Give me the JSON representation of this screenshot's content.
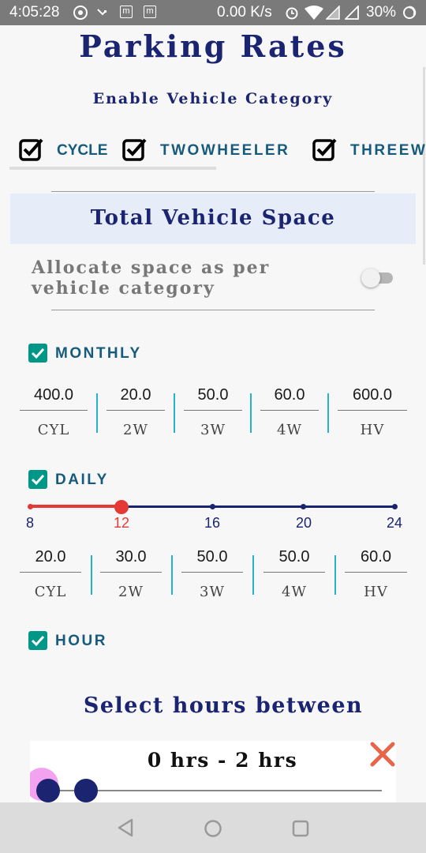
{
  "status_bar": {
    "time": "4:05:28",
    "speed": "0.00 K/s",
    "battery": "30%",
    "icons": [
      "target-icon",
      "missed-call-icon",
      "m-icon",
      "m-icon",
      "alarm-icon",
      "wifi-icon",
      "signal-icon",
      "signal-icon",
      "battery-icon"
    ]
  },
  "page": {
    "title": "Parking Rates",
    "vehicle_category_heading": "Enable Vehicle Category",
    "categories": [
      {
        "label": "CYCLE",
        "checked": true
      },
      {
        "label": "TWOWHEELER",
        "checked": true
      },
      {
        "label": "THREEWHEELER",
        "checked": true
      }
    ],
    "total_space_heading": "Total Vehicle Space",
    "allocate_label": "Allocate space as per vehicle category",
    "allocate_toggle_on": false
  },
  "monthly": {
    "label": "MONTHLY",
    "checked": true,
    "values": [
      "400.0",
      "20.0",
      "50.0",
      "60.0",
      "600.0"
    ],
    "labels": [
      "CYL",
      "2W",
      "3W",
      "4W",
      "HV"
    ]
  },
  "daily": {
    "label": "DAILY",
    "checked": true,
    "slider": {
      "ticks": [
        "8",
        "12",
        "16",
        "20",
        "24"
      ],
      "min": 8,
      "max": 24,
      "value": 12
    },
    "values": [
      "20.0",
      "30.0",
      "50.0",
      "50.0",
      "60.0"
    ],
    "labels": [
      "CYL",
      "2W",
      "3W",
      "4W",
      "HV"
    ]
  },
  "hour": {
    "label": "HOUR",
    "checked": true,
    "select_heading": "Select hours between",
    "range_text": "0 hrs - 2 hrs",
    "range": {
      "min": 0,
      "max": 2
    }
  },
  "colors": {
    "navy": "#1a2470",
    "teal": "#009688",
    "slider_active": "#e53935",
    "divider": "#26b3c7",
    "close": "#e8654a"
  },
  "nav": {
    "icons": [
      "back-icon",
      "home-icon",
      "recents-icon"
    ]
  }
}
